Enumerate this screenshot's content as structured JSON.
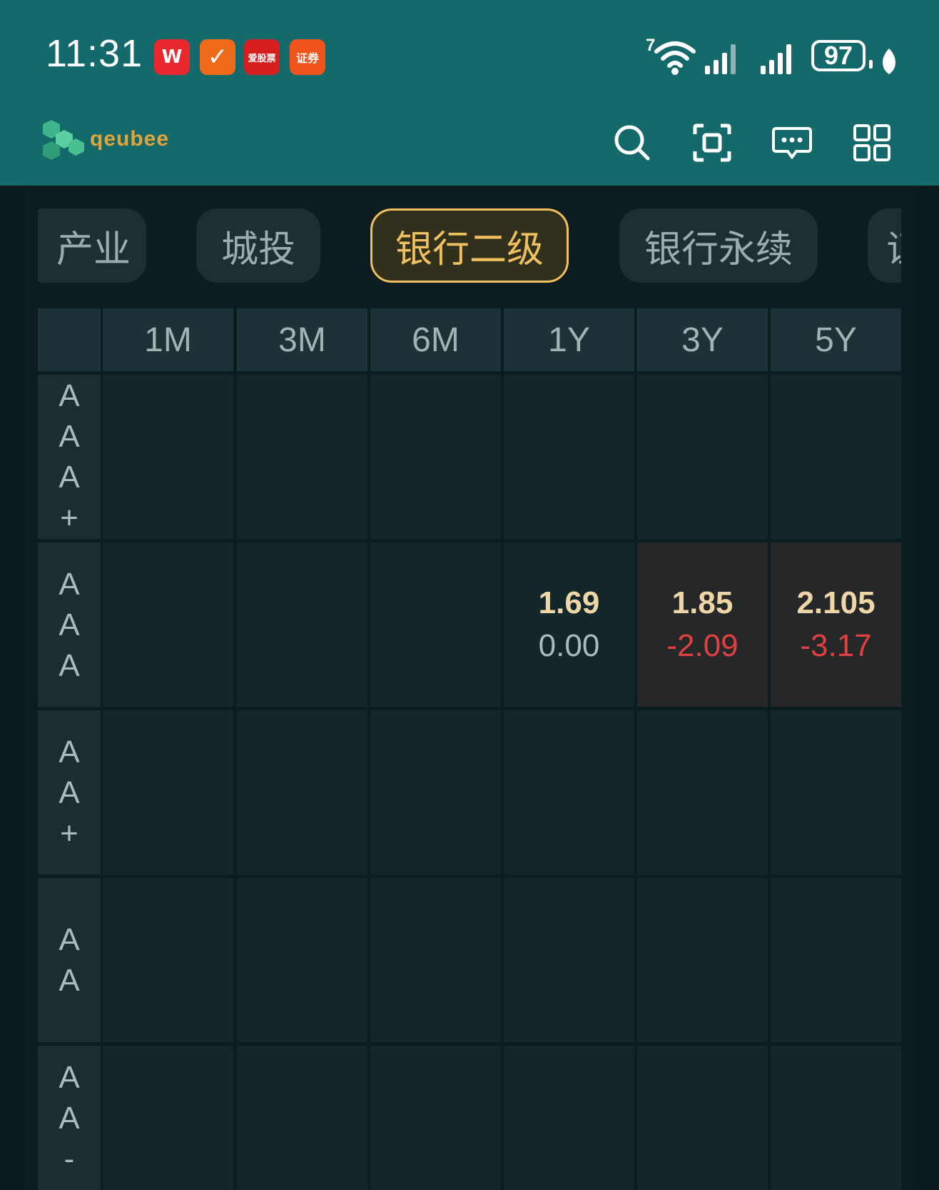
{
  "status_bar": {
    "time": "11:31",
    "app_icons": [
      {
        "name": "wps-icon",
        "label": "W",
        "color": "#e8282c"
      },
      {
        "name": "tasks-check-icon",
        "label": "✓",
        "color": "#f06a1c"
      },
      {
        "name": "aigupiao-icon",
        "label": "爱股票",
        "color": "#d81e1e"
      },
      {
        "name": "securities-icon",
        "label": "证券",
        "color": "#f0541c"
      }
    ],
    "wifi_badge": "7",
    "battery": "97"
  },
  "app_bar": {
    "logo_text": "qeubee",
    "icons": [
      "search-icon",
      "scan-icon",
      "message-icon",
      "apps-grid-icon"
    ]
  },
  "tabs": [
    {
      "label": "产业",
      "active": false
    },
    {
      "label": "城投",
      "active": false
    },
    {
      "label": "银行二级",
      "active": true
    },
    {
      "label": "银行永续",
      "active": false
    },
    {
      "label": "证",
      "active": false
    }
  ],
  "grid": {
    "columns": [
      "1M",
      "3M",
      "6M",
      "1Y",
      "3Y",
      "5Y"
    ],
    "rows": [
      {
        "rating": [
          "A",
          "A",
          "A",
          "+"
        ],
        "cells": [
          null,
          null,
          null,
          null,
          null,
          null
        ]
      },
      {
        "rating": [
          "A",
          "A",
          "A"
        ],
        "cells": [
          null,
          null,
          null,
          {
            "value": "1.69",
            "change": "0.00",
            "tone": "neutral",
            "highlight": false
          },
          {
            "value": "1.85",
            "change": "-2.09",
            "tone": "neg",
            "highlight": true
          },
          {
            "value": "2.105",
            "change": "-3.17",
            "tone": "neg",
            "highlight": true
          }
        ]
      },
      {
        "rating": [
          "A",
          "A",
          "+"
        ],
        "cells": [
          null,
          null,
          null,
          null,
          null,
          null
        ]
      },
      {
        "rating": [
          "A",
          "A"
        ],
        "cells": [
          null,
          null,
          null,
          null,
          null,
          null
        ]
      },
      {
        "rating": [
          "A",
          "A",
          "-"
        ],
        "cells": [
          null,
          null,
          null,
          null,
          null,
          null
        ]
      }
    ]
  },
  "colors": {
    "header_bg": "#14696a",
    "accent": "#f0c060",
    "negative": "#e24040"
  }
}
